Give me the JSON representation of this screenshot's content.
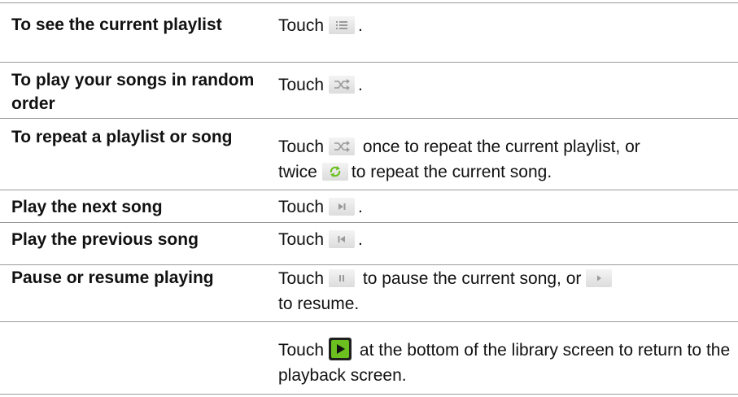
{
  "rows": [
    {
      "action": "To see the current playlist",
      "before": "Touch",
      "after": ".",
      "icon": "playlist-icon"
    },
    {
      "action": "To play your songs in random order",
      "before": "Touch",
      "after": ".",
      "icon": "shuffle-icon"
    },
    {
      "action": "To repeat a playlist or song",
      "before": "Touch",
      "after_icon1": "once to repeat the current playlist, or",
      "line2_before": "twice",
      "after": "to repeat the current song.",
      "icon": "shuffle-icon",
      "icon2": "repeat-icon"
    },
    {
      "action": "Play the next song",
      "before": "Touch",
      "after": ".",
      "icon": "next-icon"
    },
    {
      "action": "Play the previous song",
      "before": "Touch",
      "after": ".",
      "icon": "previous-icon"
    },
    {
      "action": "Pause or resume playing",
      "before": "Touch",
      "after_icon1": "to pause the current song, or",
      "after": "to resume.",
      "icon": "pause-icon",
      "icon2": "play-icon"
    },
    {
      "action": "",
      "before": "Touch",
      "after": "at the bottom of the library screen to return to the playback screen.",
      "icon": "playback-screen-icon"
    }
  ],
  "colors": {
    "rule": "#9a9a9a",
    "icon_bg": "#e6e6e6",
    "icon_glyph": "#9a9a9a",
    "accent_green": "#6bc01f",
    "dark_button": "#1f1f1f"
  }
}
